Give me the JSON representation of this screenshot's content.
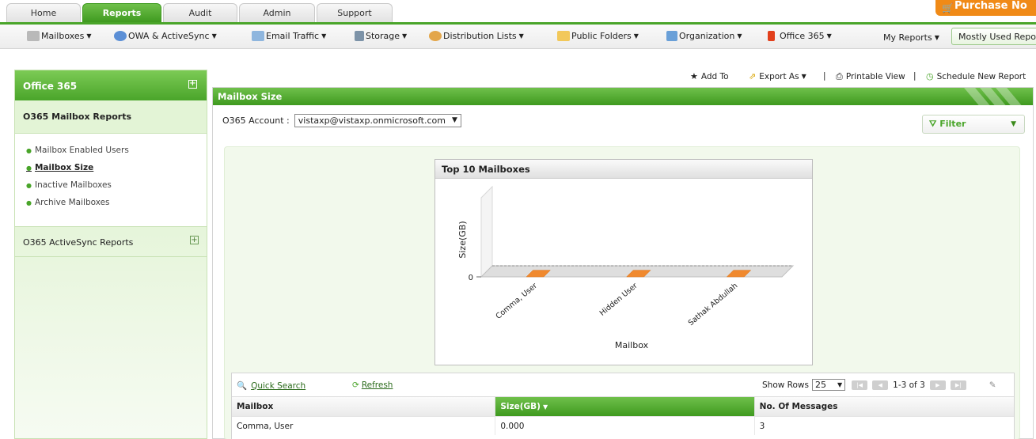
{
  "top_tabs": [
    {
      "label": "Home",
      "active": false
    },
    {
      "label": "Reports",
      "active": true
    },
    {
      "label": "Audit",
      "active": false
    },
    {
      "label": "Admin",
      "active": false
    },
    {
      "label": "Support",
      "active": false
    }
  ],
  "purchase_label": "Purchase No",
  "menu": [
    {
      "label": "Mailboxes",
      "icon": "mailbox-icon"
    },
    {
      "label": "OWA & ActiveSync",
      "icon": "owa-icon"
    },
    {
      "label": "Email Traffic",
      "icon": "email-traffic-icon"
    },
    {
      "label": "Storage",
      "icon": "storage-icon"
    },
    {
      "label": "Distribution Lists",
      "icon": "distribution-icon"
    },
    {
      "label": "Public Folders",
      "icon": "folder-icon"
    },
    {
      "label": "Organization",
      "icon": "organization-icon"
    },
    {
      "label": "Office 365",
      "icon": "office365-icon"
    },
    {
      "label": "My Reports",
      "icon": ""
    }
  ],
  "mostly_used": "Mostly Used Report",
  "sidebar": {
    "title": "Office 365",
    "section": "O365 Mailbox Reports",
    "items": [
      {
        "label": "Mailbox Enabled Users",
        "active": false
      },
      {
        "label": "Mailbox Size",
        "active": true
      },
      {
        "label": "Inactive Mailboxes",
        "active": false
      },
      {
        "label": "Archive Mailboxes",
        "active": false
      }
    ],
    "activesync": "O365 ActiveSync Reports"
  },
  "toolbar": {
    "add_to": "Add To",
    "export_as": "Export As",
    "separator": "|",
    "printable": "Printable View",
    "schedule": "Schedule New Report"
  },
  "main": {
    "title": "Mailbox Size",
    "account_label": "O365 Account :",
    "account_value": "vistaxp@vistaxp.onmicrosoft.com",
    "filter_label": "Filter"
  },
  "chart_data": {
    "type": "bar",
    "title": "Top 10 Mailboxes",
    "xlabel": "Mailbox",
    "ylabel": "Size(GB)",
    "categories": [
      "Comma, User",
      "Hidden User",
      "Sathak Abdullah"
    ],
    "values": [
      0,
      0,
      0
    ],
    "y_ticks": [
      0
    ],
    "bar_color": "#f0892e"
  },
  "grid": {
    "quick_search": "Quick Search",
    "refresh": "Refresh",
    "show_rows_label": "Show Rows",
    "rows_value": "25",
    "page_info": "1-3 of 3",
    "columns": [
      {
        "label": "Mailbox",
        "sorted": false
      },
      {
        "label": "Size(GB)",
        "sorted": true
      },
      {
        "label": "No. Of Messages",
        "sorted": false
      }
    ],
    "rows": [
      [
        "Comma, User",
        "0.000",
        "3"
      ]
    ]
  }
}
